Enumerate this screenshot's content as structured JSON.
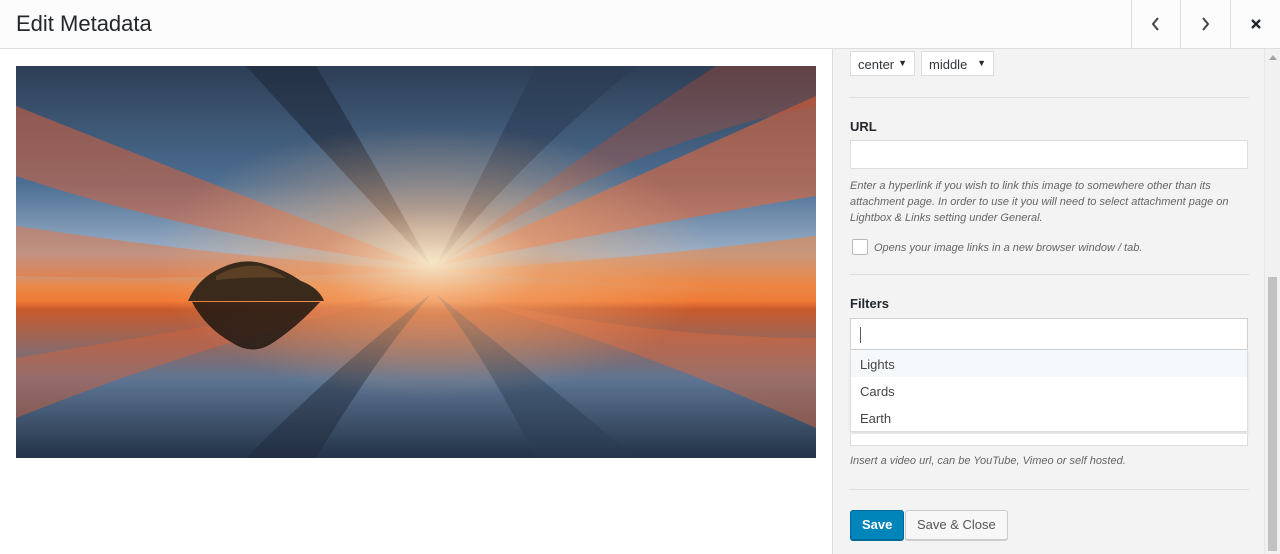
{
  "header": {
    "title": "Edit Metadata",
    "prev_icon": "chevron-left-icon",
    "next_icon": "chevron-right-icon",
    "close_icon": "close-icon"
  },
  "sidebar": {
    "align_horizontal": "center",
    "align_vertical": "middle",
    "url_label": "URL",
    "url_value": "",
    "url_description": "Enter a hyperlink if you wish to link this image to somewhere other than its attachment page. In order to use it you will need to select attachment page on Lightbox & Links setting under General.",
    "new_window_label": "Opens your image links in a new browser window / tab.",
    "new_window_checked": false,
    "filters_label": "Filters",
    "filters_value": "",
    "filter_options": [
      "Lights",
      "Cards",
      "Earth"
    ],
    "video_description": "Insert a video url, can be YouTube, Vimeo or self hosted.",
    "save_label": "Save",
    "save_close_label": "Save & Close"
  },
  "colors": {
    "primary": "#0085ba",
    "sidebar_bg": "#f3f3f3"
  }
}
